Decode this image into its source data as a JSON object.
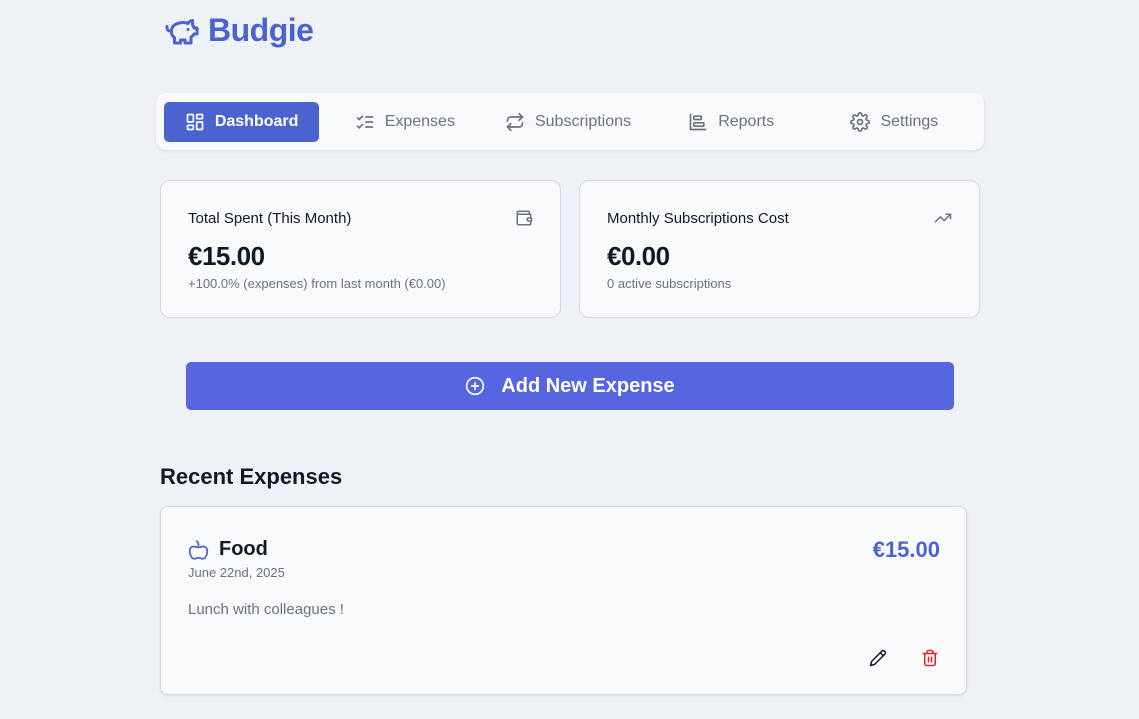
{
  "brand": {
    "title": "Budgie",
    "icon": "piggy-bank-icon",
    "color": "#4a63cf"
  },
  "nav": {
    "tabs": [
      {
        "label": "Dashboard",
        "icon": "layout-dashboard-icon",
        "active": true
      },
      {
        "label": "Expenses",
        "icon": "list-checks-icon",
        "active": false
      },
      {
        "label": "Subscriptions",
        "icon": "repeat-icon",
        "active": false
      },
      {
        "label": "Reports",
        "icon": "bar-chart-icon",
        "active": false
      },
      {
        "label": "Settings",
        "icon": "gear-icon",
        "active": false
      }
    ]
  },
  "stats": [
    {
      "label": "Total Spent (This Month)",
      "value": "€15.00",
      "sub": "+100.0% (expenses) from last month (€0.00)",
      "icon": "wallet-icon"
    },
    {
      "label": "Monthly Subscriptions Cost",
      "value": "€0.00",
      "sub": "0 active subscriptions",
      "icon": "trending-up-icon"
    }
  ],
  "add_button": {
    "label": "Add New Expense",
    "icon": "plus-circle-icon",
    "color": "#5566e0"
  },
  "recent": {
    "title": "Recent Expenses",
    "items": [
      {
        "category": "Food",
        "date": "June 22nd, 2025",
        "amount": "€15.00",
        "note": "Lunch with colleagues !",
        "icon": "apple-icon"
      }
    ]
  },
  "colors": {
    "accent": "#4a63cf",
    "danger": "#dc2626",
    "background": "#eef1f6"
  }
}
